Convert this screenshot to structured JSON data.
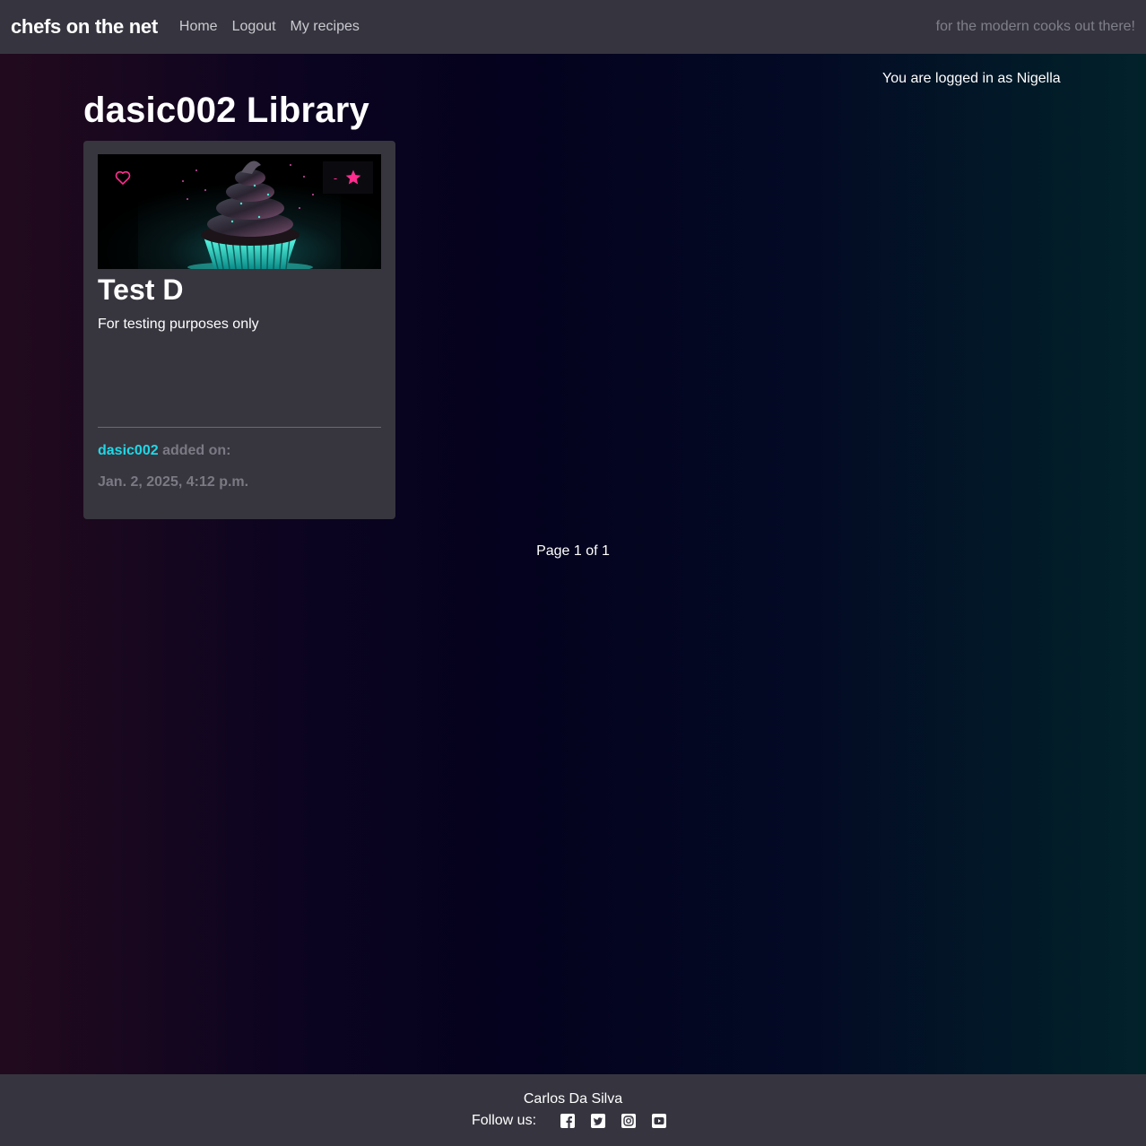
{
  "navbar": {
    "brand": "chefs on the net",
    "links": [
      {
        "label": "Home"
      },
      {
        "label": "Logout"
      },
      {
        "label": "My recipes"
      }
    ],
    "tagline": "for the modern cooks out there!"
  },
  "login_status": "You are logged in as Nigella",
  "page_title": "dasic002 Library",
  "recipe": {
    "title": "Test D",
    "description": "For testing purposes only",
    "rating": "-",
    "author": "dasic002",
    "added_on_label": "added on:",
    "date": "Jan. 2, 2025, 4:12 p.m.",
    "like_icon": "heart-outline-icon",
    "rating_icon": "star-icon",
    "accent_color": "#ff2d8e",
    "author_color": "#1fd8e6"
  },
  "pagination": "Page 1 of 1",
  "footer": {
    "name": "Carlos Da Silva",
    "follow_label": "Follow us:",
    "social_icons": [
      "facebook-icon",
      "twitter-icon",
      "instagram-icon",
      "youtube-icon"
    ]
  }
}
